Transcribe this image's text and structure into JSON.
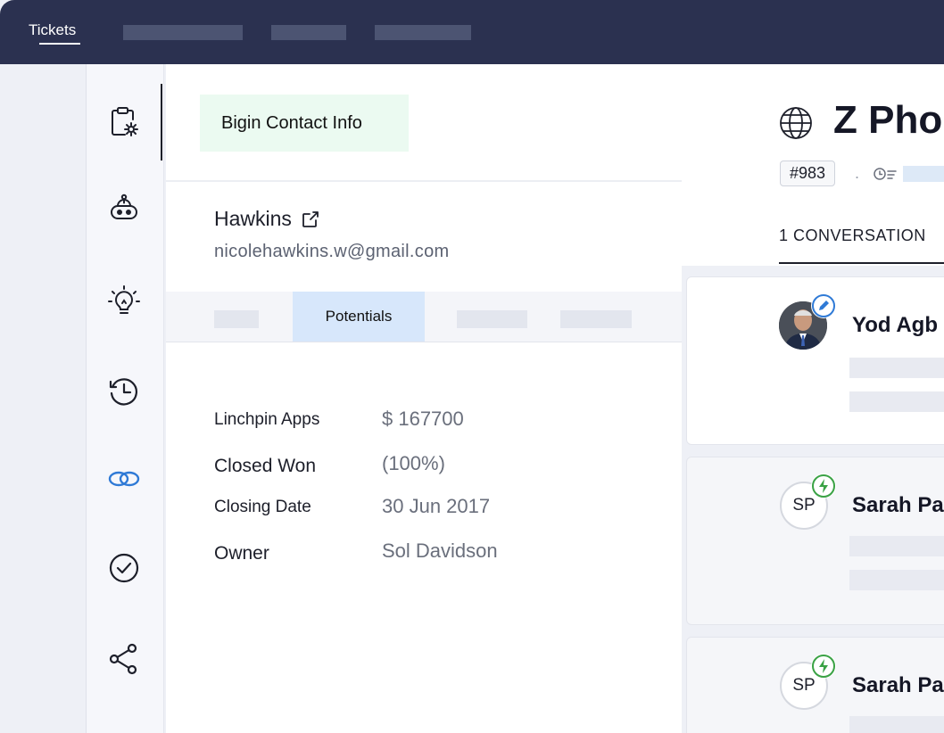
{
  "topbar": {
    "tabs": [
      {
        "label": "Tickets"
      }
    ]
  },
  "panel": {
    "title": "Bigin Contact Info",
    "contact": {
      "name": "Hawkins",
      "email": "nicolehawkins.w@gmail.com"
    },
    "active_tab": "Potentials",
    "fields": [
      {
        "label": "Linchpin Apps",
        "value": "$ 167700"
      },
      {
        "label": "Closed Won",
        "value": "(100%)"
      },
      {
        "label": "Closing Date",
        "value": "30 Jun 2017"
      },
      {
        "label": "Owner",
        "value": "Sol Davidson"
      }
    ]
  },
  "ticket": {
    "subject": "Z Phon",
    "id": "#983",
    "separator": ".",
    "conversation_tab": "1 CONVERSATION"
  },
  "conversations": [
    {
      "sender": "Yod Agb",
      "avatar": "photo",
      "badge_icon": "pencil-icon",
      "badge_color": "#2f7ad6"
    },
    {
      "sender": "Sarah Pa",
      "avatar_initials": "SP",
      "badge_icon": "bolt-icon",
      "badge_color": "#3aa245"
    },
    {
      "sender": "Sarah Pa",
      "avatar_initials": "SP",
      "badge_icon": "bolt-icon",
      "badge_color": "#3aa245"
    }
  ],
  "rail_icons": [
    "clipboard-gear-icon",
    "bot-icon",
    "lightbulb-icon",
    "history-icon",
    "bigin-link-icon",
    "check-circle-icon",
    "share-icon"
  ],
  "colors": {
    "topbar": "#2b3150",
    "accent_blue": "#2f7ad6",
    "success_green": "#3aa245",
    "active_tab_bg": "#d7e7fb",
    "tag_bg": "#ebfaf1"
  }
}
